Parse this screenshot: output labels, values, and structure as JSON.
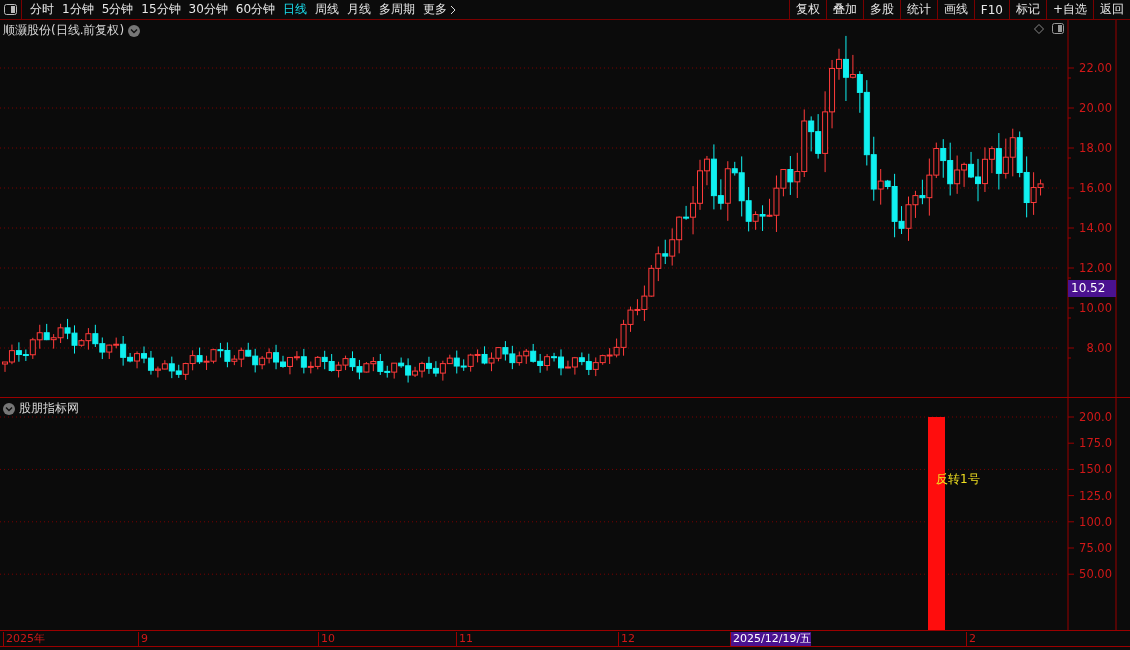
{
  "toolbar": {
    "periods": [
      {
        "label": "分时",
        "selected": false
      },
      {
        "label": "1分钟",
        "selected": false
      },
      {
        "label": "5分钟",
        "selected": false
      },
      {
        "label": "15分钟",
        "selected": false
      },
      {
        "label": "30分钟",
        "selected": false
      },
      {
        "label": "60分钟",
        "selected": false
      },
      {
        "label": "日线",
        "selected": true
      },
      {
        "label": "周线",
        "selected": false
      },
      {
        "label": "月线",
        "selected": false
      },
      {
        "label": "多周期",
        "selected": false
      },
      {
        "label": "更多",
        "selected": false
      }
    ],
    "actions": [
      "复权",
      "叠加",
      "多股",
      "统计",
      "画线",
      "F10",
      "标记",
      "+自选",
      "返回"
    ]
  },
  "main_panel": {
    "title": "顺灏股份(日线.前复权)",
    "price_axis": [
      "22.00",
      "20.00",
      "18.00",
      "16.00",
      "14.00",
      "12.00",
      "10.00",
      "8.00"
    ],
    "last_price": "10.52"
  },
  "indicator_panel": {
    "title": "股朋指标网",
    "signal_label": "反转1号",
    "value_axis": [
      "200.0",
      "175.0",
      "150.0",
      "125.0",
      "100.0",
      "75.00",
      "50.00"
    ]
  },
  "time_axis": [
    {
      "label": "2025年",
      "kind": "tick"
    },
    {
      "label": "9",
      "kind": "tick"
    },
    {
      "label": "10",
      "kind": "tick"
    },
    {
      "label": "11",
      "kind": "tick"
    },
    {
      "label": "12",
      "kind": "tick"
    },
    {
      "label": "2025/12/19/五",
      "kind": "cursor"
    },
    {
      "label": "2",
      "kind": "tick"
    }
  ]
}
